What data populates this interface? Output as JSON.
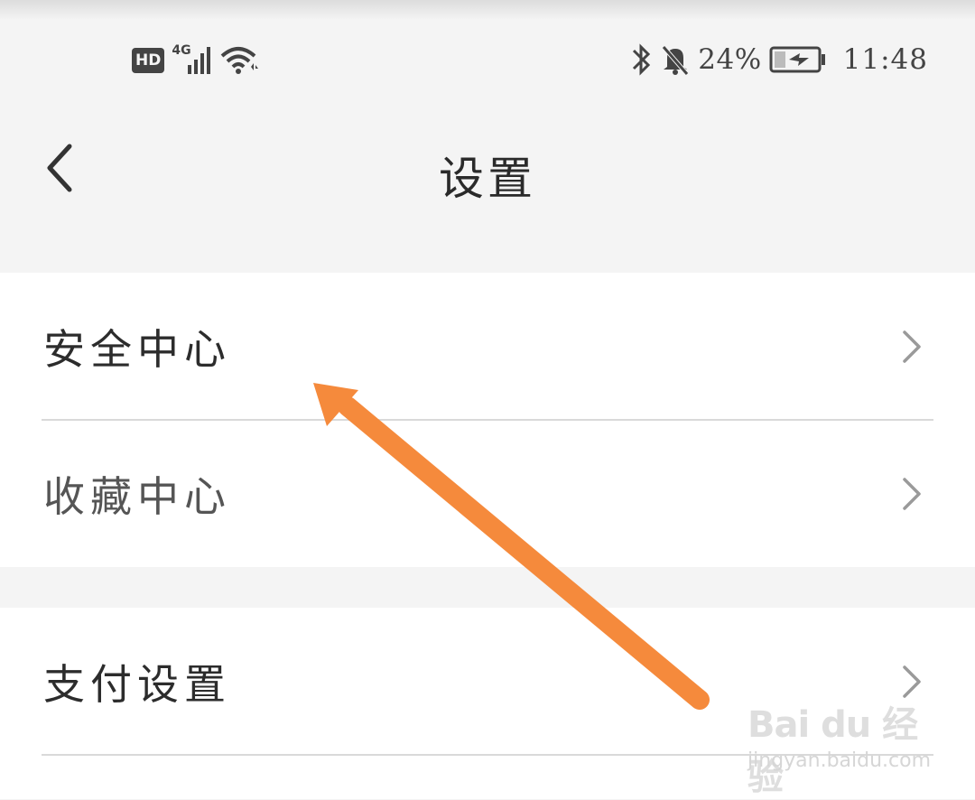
{
  "status_bar": {
    "hd_label": "HD",
    "network_label": "4G",
    "battery_percent": "24%",
    "time": "11:48",
    "icons": [
      "signal-icon",
      "wifi-icon",
      "bluetooth-icon",
      "bell-muted-icon",
      "battery-charging-icon"
    ]
  },
  "header": {
    "title": "设置",
    "back_icon": "chevron-left-icon"
  },
  "settings": {
    "items": [
      {
        "label": "安全中心",
        "icon": "chevron-right-icon"
      },
      {
        "label": "收藏中心",
        "icon": "chevron-right-icon"
      },
      {
        "label": "支付设置",
        "icon": "chevron-right-icon"
      }
    ]
  },
  "annotation": {
    "arrow_color": "#f58a3c"
  },
  "watermark": {
    "brand": "Bai du 经验",
    "url": "jingyan.baidu.com"
  },
  "colors": {
    "background": "#f4f4f4",
    "surface": "#ffffff",
    "text": "#2a2a2a",
    "divider": "#d9d9d9"
  }
}
